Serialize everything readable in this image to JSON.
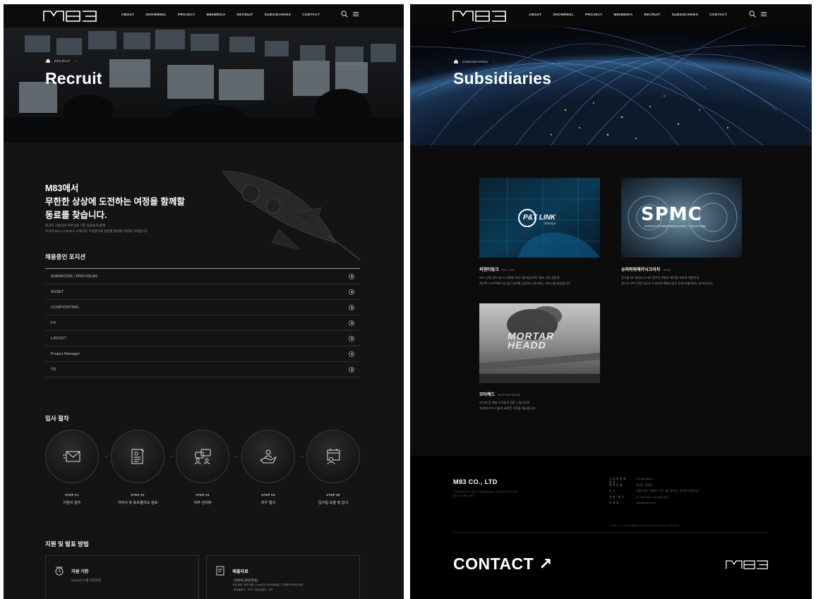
{
  "brand": {
    "logo_text": "M83"
  },
  "nav": {
    "items": [
      "ABOUT",
      "SHOWREEL",
      "PROJECT",
      "M83MEDIA",
      "RECRUIT",
      "SUBSIDIARIES",
      "CONTACT"
    ]
  },
  "recruit": {
    "breadcrumb": "RECRUIT",
    "title": "Recruit",
    "intro_title_lines": [
      "M83에서",
      "무한한 상상에 도전하는 여정을 함께할",
      "동료를 찾습니다."
    ],
    "intro_desc_lines": [
      "최고의 기술력과 자부심을 가진 동료들과 함께",
      "아시아 NO.1 CG/VFX 스튜디오 우성할으로 성장할 탈성에 지원을 기대합니다."
    ],
    "positions_title": "채용중인 포지션",
    "positions": [
      "ANIMATION / PREVISUAL",
      "ASSET",
      "COMPOSITING",
      "FX",
      "LAYOUT",
      "Project Manager",
      "TD"
    ],
    "process_title": "입사 절차",
    "steps": [
      {
        "no": "STEP 01",
        "label": "지원서 접수",
        "icon": "envelope-icon"
      },
      {
        "no": "STEP 02",
        "label": "이력서 및 포트폴리오 검토",
        "icon": "resume-icon"
      },
      {
        "no": "STEP 03",
        "label": "직무 인터뷰",
        "icon": "interview-icon"
      },
      {
        "no": "STEP 04",
        "label": "처우 협의",
        "icon": "handshake-icon"
      },
      {
        "no": "STEP 05",
        "label": "입사일 조율 및 입사",
        "icon": "calendar-icon"
      }
    ],
    "apply_title": "지원 및 발표 방법",
    "boxes": [
      {
        "title": "지원 기한",
        "desc_lines": [
          "2024년 07월 미정까지"
        ],
        "icon": "clock-icon"
      },
      {
        "title": "제출자료",
        "desc_lines": [
          "- 이력서 (자유양식)",
          "사본 증빙, 경력 연봉, E-mail 등 인적사항 필수 기재하여 보내주세요.",
          "- 포트폴리오 - PDF / 동영상링크 - ZIP"
        ],
        "icon": "document-icon"
      }
    ]
  },
  "subsidiaries": {
    "breadcrumb": "SUBSIDIARIES",
    "title": "Subsidiaries",
    "cards": [
      {
        "name": "피엔티링크",
        "sub": "P&T LINK",
        "logo": "P&T LINK",
        "logo_sub": "피엔티링크",
        "desc_lines": [
          "VFX 산업 정보 및 AI 고화질 서비스를 제공하며, 제조 산업 현장에",
          "혁신적 소프트웨어 및 업무 장비를 공급하고 관리하는 서비스를 제공합니다."
        ]
      },
      {
        "name": "슈퍼파워메카닉크리처",
        "sub": "SPMC",
        "logo": "SPMC",
        "logo_sub": "SUPER POWER MECHANIC CREATURE",
        "desc_lines": [
          "한국형 SF 캐릭터, K-SF 장르의 콘텐츠 제작을 위하여 대한민국",
          "최고의 VFX 전문가들과 각 분야의 예술인들이 함께 만들어가는 회사입니다."
        ]
      },
      {
        "name": "모터헤드",
        "sub": "MORTAR HEADD",
        "logo": "MORTAR HEADD",
        "logo_sub": "",
        "desc_lines": [
          "크리처 및 대형 시각효과 전문 스튜디오로",
          "차세대 VFX 기술의 새로운 기준을 제시합니다."
        ]
      }
    ]
  },
  "footer": {
    "company": "M83 CO., LTD",
    "address_lines": [
      "Gwanak-ro 17-gil 6, Gwangjin-gu, Seoul, KR 04786",
      "경기도 가평, M83"
    ],
    "info": [
      {
        "k": "사업자등록번호",
        "v": "210-86-05623"
      },
      {
        "k": "대표자명",
        "v": "정성진, 정성현"
      },
      {
        "k": "주소",
        "v": "서울 가회구 청화로 17번, 4층 (중곡동, 유포셀 사회유치)"
      },
      {
        "k": "전화/팩스",
        "v": "02-318-0529 / 02-318-0521"
      },
      {
        "k": "이메일",
        "v": "m83@m83.co.kr"
      }
    ],
    "copyright": "© M83 Co., Ltd. All Rights Reserved. Web Site By FIREFARM",
    "contact_label": "CONTACT ↗"
  }
}
